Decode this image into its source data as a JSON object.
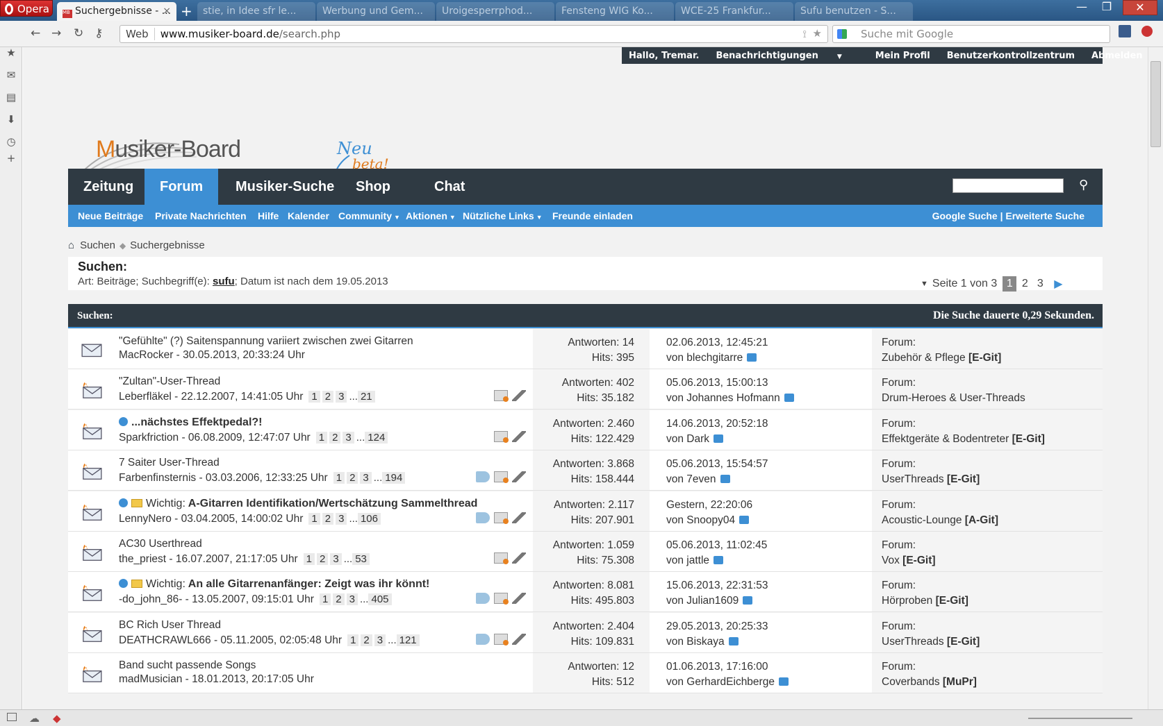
{
  "browser": {
    "menu_label": "Opera",
    "active_tab": "Suchergebnisse - ...",
    "bg_tabs": [
      "stie, in Idee sfr le...",
      "Werbung und Gem...",
      "Uroigesperrphod...",
      "Fensteng WIG Ko...",
      "WCE-25 Frankfur...",
      "Sufu benutzen - S..."
    ],
    "url_scheme_label": "Web",
    "url_host": "www.musiker-board.de",
    "url_path": "/search.php",
    "search_placeholder": "Suche mit Google"
  },
  "userbar": {
    "greeting": "Hallo, Tremar.",
    "notifications": "Benachrichtigungen",
    "profile": "Mein Profil",
    "control_panel": "Benutzerkontrollzentrum",
    "logout": "Abmelden"
  },
  "logo": {
    "text_m": "M",
    "text_rest": "usiker-Board",
    "neu": "Neu",
    "beta": "beta!"
  },
  "nav": {
    "tabs": [
      "Zeitung",
      "Forum",
      "Musiker-Suche",
      "Shop",
      "Chat"
    ],
    "active": "Forum"
  },
  "subnav": {
    "items": [
      "Neue Beiträge",
      "Private Nachrichten",
      "Hilfe",
      "Kalender",
      "Community",
      "Aktionen",
      "Nützliche Links",
      "Freunde einladen"
    ],
    "right": "Google Suche | Erweiterte Suche"
  },
  "breadcrumb": {
    "first": "Suchen",
    "second": "Suchergebnisse"
  },
  "search": {
    "heading": "Suchen:",
    "criteria_prefix": "Art: Beiträge; Suchbegriff(e):",
    "term": "sufu",
    "criteria_suffix": "; Datum ist nach dem 19.05.2013"
  },
  "pager": {
    "label": "Seite 1 von 3",
    "pages": [
      "1",
      "2",
      "3"
    ],
    "current": "1"
  },
  "results_header": {
    "left": "Suchen:",
    "right": "Die Suche dauerte 0,29 Sekunden."
  },
  "rows": [
    {
      "prefix": "",
      "title": "\"Gefühlte\" (?) Saitenspannung variiert zwischen zwei Gitarren",
      "meta": "MacRocker - 30.05.2013, 20:33:24 Uhr",
      "pages": [],
      "replies": "Antworten: 14",
      "hits": "Hits: 395",
      "date": "02.06.2013, 12:45:21",
      "by": "von blechgitarre",
      "forum_label": "Forum:",
      "forum": "Zubehör & Pflege",
      "tag": "[E-Git]"
    },
    {
      "prefix": "",
      "title": "\"Zultan\"-User-Thread",
      "meta": "Leberfläkel - 22.12.2007, 14:41:05 Uhr",
      "pages": [
        "1",
        "2",
        "3",
        "...",
        "21"
      ],
      "replies": "Antworten: 402",
      "hits": "Hits: 35.182",
      "date": "05.06.2013, 15:00:13",
      "by": "von Johannes Hofmann",
      "forum_label": "Forum:",
      "forum": "Drum-Heroes & User-Threads",
      "tag": ""
    },
    {
      "prefix": "",
      "title": "...nächstes Effektpedal?!",
      "meta": "Sparkfriction - 06.08.2009, 12:47:07 Uhr",
      "pages": [
        "1",
        "2",
        "3",
        "...",
        "124"
      ],
      "replies": "Antworten: 2.460",
      "hits": "Hits: 122.429",
      "date": "14.06.2013, 20:52:18",
      "by": "von Dark",
      "forum_label": "Forum:",
      "forum": "Effektgeräte & Bodentreter",
      "tag": "[E-Git]"
    },
    {
      "prefix": "",
      "title": "7 Saiter User-Thread",
      "meta": "Farbenfinsternis - 03.03.2006, 12:33:25 Uhr",
      "pages": [
        "1",
        "2",
        "3",
        "...",
        "194"
      ],
      "replies": "Antworten: 3.868",
      "hits": "Hits: 158.444",
      "date": "05.06.2013, 15:54:57",
      "by": "von 7even",
      "forum_label": "Forum:",
      "forum": "UserThreads",
      "tag": "[E-Git]"
    },
    {
      "prefix": "Wichtig:",
      "title": "A-Gitarren Identifikation/Wertschätzung Sammelthread",
      "meta": "LennyNero - 03.04.2005, 14:00:02 Uhr",
      "pages": [
        "1",
        "2",
        "3",
        "...",
        "106"
      ],
      "replies": "Antworten: 2.117",
      "hits": "Hits: 207.901",
      "date": "Gestern, 22:20:06",
      "by": "von Snoopy04",
      "forum_label": "Forum:",
      "forum": "Acoustic-Lounge",
      "tag": "[A-Git]"
    },
    {
      "prefix": "",
      "title": "AC30 Userthread",
      "meta": "the_priest - 16.07.2007, 21:17:05 Uhr",
      "pages": [
        "1",
        "2",
        "3",
        "...",
        "53"
      ],
      "replies": "Antworten: 1.059",
      "hits": "Hits: 75.308",
      "date": "05.06.2013, 11:02:45",
      "by": "von jattle",
      "forum_label": "Forum:",
      "forum": "Vox",
      "tag": "[E-Git]"
    },
    {
      "prefix": "Wichtig:",
      "title": "An alle Gitarrenanfänger: Zeigt was ihr könnt!",
      "meta": "-do_john_86- - 13.05.2007, 09:15:01 Uhr",
      "pages": [
        "1",
        "2",
        "3",
        "...",
        "405"
      ],
      "replies": "Antworten: 8.081",
      "hits": "Hits: 495.803",
      "date": "15.06.2013, 22:31:53",
      "by": "von Julian1609",
      "forum_label": "Forum:",
      "forum": "Hörproben",
      "tag": "[E-Git]"
    },
    {
      "prefix": "",
      "title": "BC Rich User Thread",
      "meta": "DEATHCRAWL666 - 05.11.2005, 02:05:48 Uhr",
      "pages": [
        "1",
        "2",
        "3",
        "...",
        "121"
      ],
      "replies": "Antworten: 2.404",
      "hits": "Hits: 109.831",
      "date": "29.05.2013, 20:25:33",
      "by": "von Biskaya",
      "forum_label": "Forum:",
      "forum": "UserThreads",
      "tag": "[E-Git]"
    },
    {
      "prefix": "",
      "title": "Band sucht passende Songs",
      "meta": "madMusician - 18.01.2013, 20:17:05 Uhr",
      "pages": [],
      "replies": "Antworten: 12",
      "hits": "Hits: 512",
      "date": "01.06.2013, 17:16:00",
      "by": "von GerhardEichberge",
      "forum_label": "Forum:",
      "forum": "Coverbands",
      "tag": "[MuPr]"
    }
  ],
  "colors": {
    "dark": "#2f3a43",
    "accent": "#3d8fd4",
    "opera_red": "#cc2222"
  }
}
